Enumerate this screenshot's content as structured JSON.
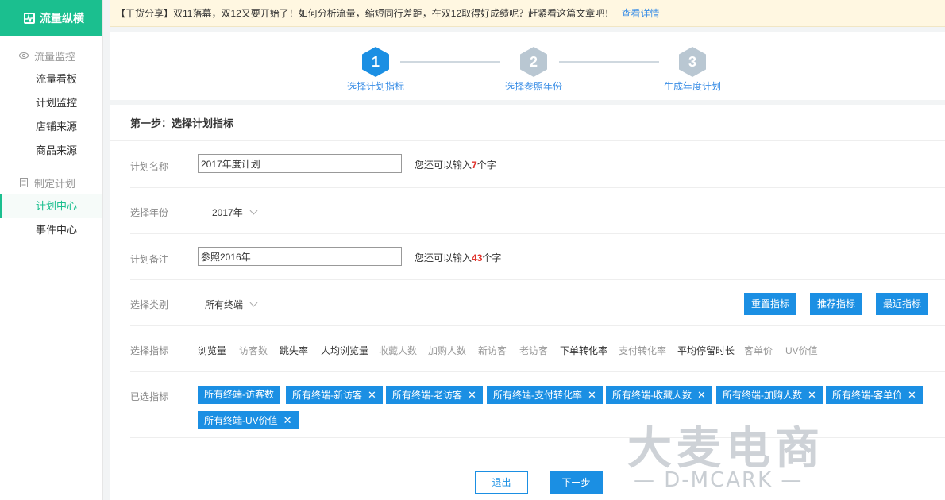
{
  "brand": {
    "title": "流量纵横"
  },
  "sidebar": {
    "groups": [
      {
        "label": "流量监控",
        "icon": "eye-icon",
        "items": [
          {
            "label": "流量看板"
          },
          {
            "label": "计划监控"
          },
          {
            "label": "店铺来源"
          },
          {
            "label": "商品来源"
          }
        ]
      },
      {
        "label": "制定计划",
        "icon": "document-icon",
        "items": [
          {
            "label": "计划中心",
            "active": true
          },
          {
            "label": "事件中心"
          }
        ]
      }
    ]
  },
  "notice": {
    "text": "【干货分享】双11落幕，双12又要开始了！如何分析流量，缩短同行差距，在双12取得好成绩呢？赶紧看这篇文章吧！",
    "link": "查看详情"
  },
  "steps": [
    {
      "num": "1",
      "label": "选择计划指标",
      "state": "active"
    },
    {
      "num": "2",
      "label": "选择参照年份",
      "state": "inactive"
    },
    {
      "num": "3",
      "label": "生成年度计划",
      "state": "inactive"
    }
  ],
  "colors": {
    "accent": "#1bbf8f",
    "primary": "#1b8fe3",
    "step_active": "#1b8fe3",
    "step_inactive": "#b9c7d2",
    "highlight": "#e0322b"
  },
  "form": {
    "title": "第一步：选择计划指标",
    "plan_name": {
      "label": "计划名称",
      "value": "2017年度计划",
      "hint_prefix": "您还可以输入",
      "hint_num": "7",
      "hint_suffix": "个字"
    },
    "year": {
      "label": "选择年份",
      "value": "2017年"
    },
    "remark": {
      "label": "计划备注",
      "value": "参照2016年",
      "hint_prefix": "您还可以输入",
      "hint_num": "43",
      "hint_suffix": "个字"
    },
    "category": {
      "label": "选择类别",
      "value": "所有终端",
      "buttons": [
        "重置指标",
        "推荐指标",
        "最近指标"
      ]
    },
    "metrics": {
      "label": "选择指标",
      "items": [
        {
          "label": "浏览量",
          "on": true
        },
        {
          "label": "访客数",
          "on": false
        },
        {
          "label": "跳失率",
          "on": true
        },
        {
          "label": "人均浏览量",
          "on": true
        },
        {
          "label": "收藏人数",
          "on": false
        },
        {
          "label": "加购人数",
          "on": false
        },
        {
          "label": "新访客",
          "on": false
        },
        {
          "label": "老访客",
          "on": false
        },
        {
          "label": "下单转化率",
          "on": true
        },
        {
          "label": "支付转化率",
          "on": false
        },
        {
          "label": "平均停留时长",
          "on": true
        },
        {
          "label": "客单价",
          "on": false
        },
        {
          "label": "UV价值",
          "on": false
        }
      ]
    },
    "selected": {
      "label": "已选指标",
      "tags": [
        {
          "label": "所有终端-访客数",
          "removable": false
        },
        {
          "label": "所有终端-新访客",
          "removable": true
        },
        {
          "label": "所有终端-老访客",
          "removable": true
        },
        {
          "label": "所有终端-支付转化率",
          "removable": true
        },
        {
          "label": "所有终端-收藏人数",
          "removable": true
        },
        {
          "label": "所有终端-加购人数",
          "removable": true
        },
        {
          "label": "所有终端-客单价",
          "removable": true
        },
        {
          "label": "所有终端-UV价值",
          "removable": true
        }
      ]
    }
  },
  "footer": {
    "exit": "退出",
    "next": "下一步"
  },
  "watermark": {
    "title": "大麦电商",
    "sub": "— D-MCARK —"
  }
}
